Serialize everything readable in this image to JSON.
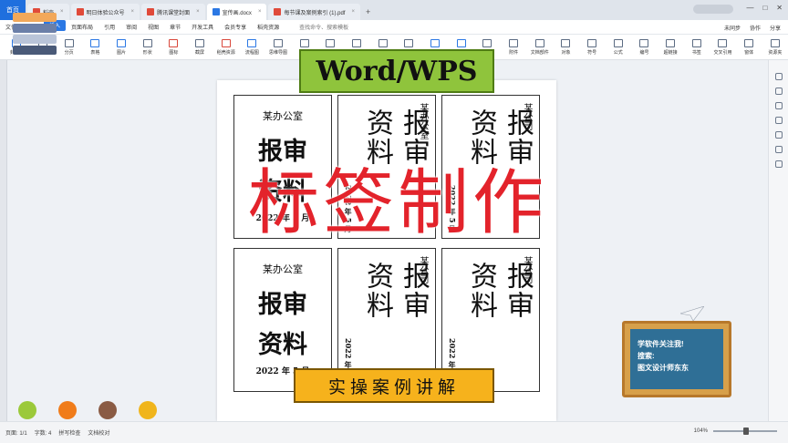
{
  "tabs": {
    "home": "首页",
    "docs": [
      {
        "label": "稻壳",
        "color": "#e04a3a",
        "active": false
      },
      {
        "label": "明日体验公众号",
        "color": "#e04a3a",
        "active": false
      },
      {
        "label": "腾讯课堂封面",
        "color": "#e04a3a",
        "active": false
      },
      {
        "label": "宣传画.docx",
        "color": "#2b78e4",
        "active": true
      },
      {
        "label": "每节课及案例索引 (1).pdf",
        "color": "#e04a3a",
        "active": false
      }
    ],
    "new_tab": "+"
  },
  "menu": {
    "items": [
      "文件",
      "开始",
      "插入",
      "页面布局",
      "引用",
      "审阅",
      "视图",
      "章节",
      "开发工具",
      "会员专享",
      "稻壳资源"
    ],
    "active_index": 2,
    "search": "查找命令、搜索模板",
    "right": [
      "未同步",
      "协作",
      "分享"
    ]
  },
  "ribbon": [
    {
      "label": "封面页",
      "tone": "blue"
    },
    {
      "label": "空白页",
      "tone": ""
    },
    {
      "label": "分页",
      "tone": ""
    },
    {
      "label": "表格",
      "tone": "blue"
    },
    {
      "label": "图片",
      "tone": "blue"
    },
    {
      "label": "形状",
      "tone": ""
    },
    {
      "label": "图标",
      "tone": "red"
    },
    {
      "label": "截屏",
      "tone": ""
    },
    {
      "label": "稻壳资源",
      "tone": "red"
    },
    {
      "label": "流程图",
      "tone": "blue"
    },
    {
      "label": "思维导图",
      "tone": ""
    },
    {
      "label": "更多",
      "tone": ""
    },
    {
      "label": "批注",
      "tone": ""
    },
    {
      "label": "页眉页脚",
      "tone": ""
    },
    {
      "label": "页码",
      "tone": ""
    },
    {
      "label": "水印",
      "tone": ""
    },
    {
      "label": "文本框",
      "tone": "blue"
    },
    {
      "label": "艺术字",
      "tone": "blue"
    },
    {
      "label": "日期",
      "tone": ""
    },
    {
      "label": "附件",
      "tone": ""
    },
    {
      "label": "文档部件",
      "tone": ""
    },
    {
      "label": "对象",
      "tone": ""
    },
    {
      "label": "符号",
      "tone": ""
    },
    {
      "label": "公式",
      "tone": ""
    },
    {
      "label": "编号",
      "tone": ""
    },
    {
      "label": "超链接",
      "tone": ""
    },
    {
      "label": "书签",
      "tone": ""
    },
    {
      "label": "交叉引用",
      "tone": ""
    },
    {
      "label": "窗体",
      "tone": ""
    },
    {
      "label": "资源夹",
      "tone": ""
    }
  ],
  "labels": [
    {
      "org": "某办公室",
      "big": [
        "报审",
        "资料"
      ],
      "date": "2022 年 5 月",
      "orient": "h"
    },
    {
      "org": "某办公室",
      "big": [
        "报审",
        "资料"
      ],
      "date": "2022 年 5 月",
      "orient": "v"
    },
    {
      "org": "某公司",
      "big": [
        "报审",
        "资料"
      ],
      "date": "2022 年 5 月",
      "orient": "v"
    },
    {
      "org": "某办公室",
      "big": [
        "报审",
        "资料"
      ],
      "date": "2022 年 5 月",
      "orient": "h"
    },
    {
      "org": "某公司",
      "big": [
        "报审",
        "资料"
      ],
      "date": "2022 年 5 月",
      "orient": "v"
    },
    {
      "org": "某公司",
      "big": [
        "报审",
        "资料"
      ],
      "date": "2022 年 5 月",
      "orient": "v"
    }
  ],
  "overlay": {
    "title": "Word/WPS",
    "headline": "标签制作",
    "subtitle": "实操案例讲解",
    "board_line1": "学软件关注我!",
    "board_line2": "搜索:",
    "board_line3": "图文设计师东东"
  },
  "colors": {
    "accent": "#2b78e4",
    "headline": "#e3232b",
    "title_bg": "#8fc43c",
    "subtitle_bg": "#f6b21c",
    "dots": [
      "#9bc93a",
      "#f07c1a",
      "#8a5b44",
      "#f0b51c"
    ]
  },
  "status": {
    "page": "页面: 1/1",
    "words": "字数: 4",
    "spell": "拼写检查",
    "proof": "文档校对",
    "zoom": "104%",
    "zoom_fraction": 0.52
  }
}
